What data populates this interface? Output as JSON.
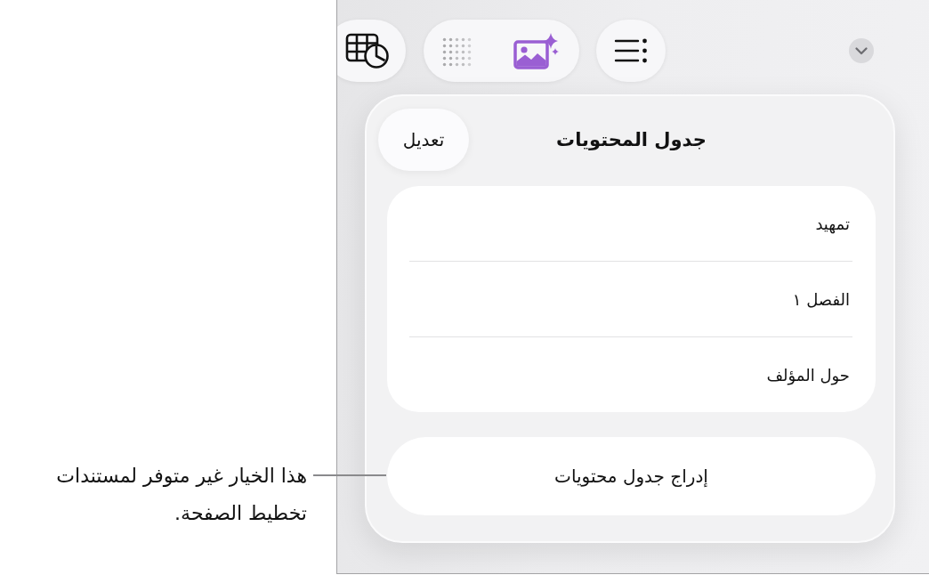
{
  "callout": {
    "text": "هذا الخيار غير متوفر لمستندات تخطيط الصفحة."
  },
  "popover": {
    "title": "جدول المحتويات",
    "edit_button": "تعديل",
    "entries": [
      "تمهيد",
      "الفصل ١",
      "حول المؤلف"
    ],
    "insert_button": "إدراج جدول محتويات"
  }
}
